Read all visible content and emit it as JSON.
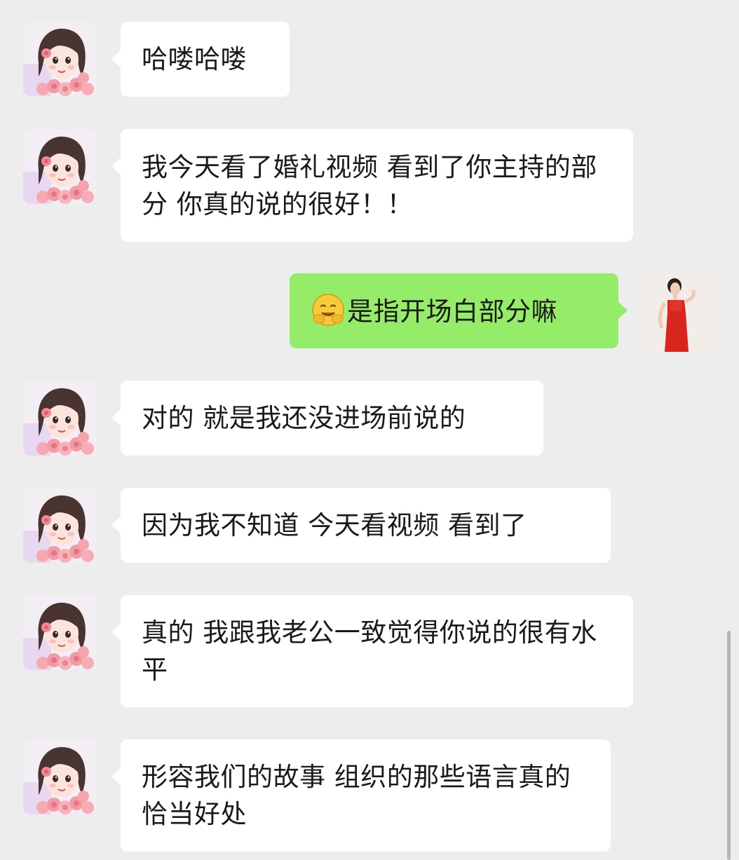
{
  "chat": {
    "messages": [
      {
        "sender": "contact",
        "text": "哈喽哈喽"
      },
      {
        "sender": "contact",
        "text": "我今天看了婚礼视频 看到了你主持的部分 你真的说的很好！！"
      },
      {
        "sender": "self",
        "emoji": "hugging-face-emoji",
        "text": "是指开场白部分嘛"
      },
      {
        "sender": "contact",
        "text": "对的 就是我还没进场前说的"
      },
      {
        "sender": "contact",
        "text": "因为我不知道 今天看视频 看到了"
      },
      {
        "sender": "contact",
        "text": "真的 我跟我老公一致觉得你说的很有水平"
      },
      {
        "sender": "contact",
        "text": "形容我们的故事 组织的那些语言真的恰当好处"
      }
    ]
  },
  "colors": {
    "background": "#ededed",
    "incoming_bubble": "#ffffff",
    "outgoing_bubble": "#95ec69",
    "text": "#1a1a1a"
  },
  "icons": {
    "contact_avatar": "cartoon-woman-with-roses-avatar",
    "self_avatar": "woman-in-red-dress-avatar"
  }
}
